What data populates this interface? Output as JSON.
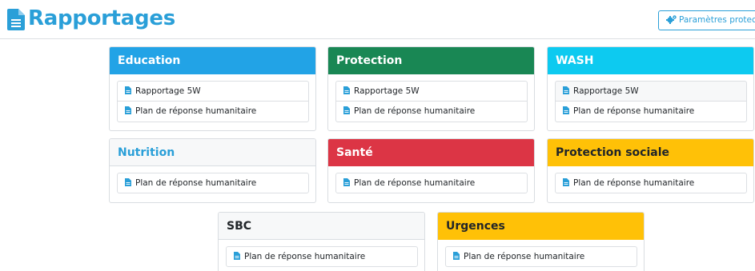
{
  "header": {
    "title": "Rapportages",
    "params_button": "Paramètres protection"
  },
  "colors": {
    "title": "#2a9fd8",
    "education": "#22a3e6",
    "protection": "#198754",
    "wash": "#0dcaf0",
    "neutral": "#f7f8f9",
    "sante": "#dc3545",
    "warning": "#ffc107",
    "doc_icon": "#2a9fd8"
  },
  "cards": [
    {
      "id": "education",
      "title": "Education",
      "items": [
        "Rapportage 5W",
        "Plan de réponse humanitaire"
      ]
    },
    {
      "id": "protection",
      "title": "Protection",
      "items": [
        "Rapportage 5W",
        "Plan de réponse humanitaire"
      ]
    },
    {
      "id": "wash",
      "title": "WASH",
      "items": [
        "Rapportage 5W",
        "Plan de réponse humanitaire"
      ]
    },
    {
      "id": "nutrition",
      "title": "Nutrition",
      "items": [
        "Plan de réponse humanitaire"
      ]
    },
    {
      "id": "sante",
      "title": "Santé",
      "items": [
        "Plan de réponse humanitaire"
      ]
    },
    {
      "id": "protection-sociale",
      "title": "Protection sociale",
      "items": [
        "Plan de réponse humanitaire"
      ]
    },
    {
      "id": "sbc",
      "title": "SBC",
      "items": [
        "Plan de réponse humanitaire"
      ]
    },
    {
      "id": "urgences",
      "title": "Urgences",
      "items": [
        "Plan de réponse humanitaire"
      ]
    }
  ]
}
